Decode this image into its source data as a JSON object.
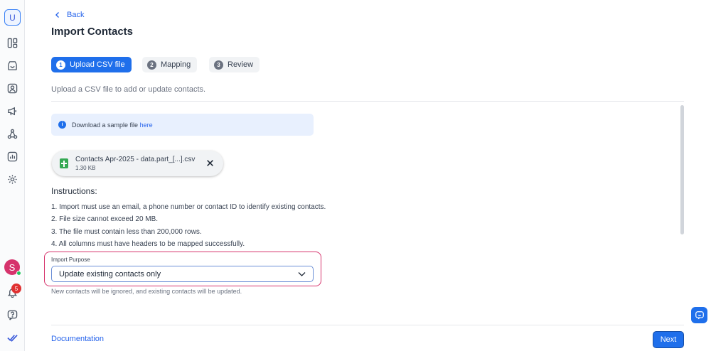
{
  "sidebar": {
    "logo_letter": "U",
    "items": [
      {
        "icon": "layout-icon"
      },
      {
        "icon": "inbox-icon"
      },
      {
        "icon": "contacts-icon"
      },
      {
        "icon": "megaphone-icon"
      },
      {
        "icon": "workflow-icon"
      },
      {
        "icon": "reports-icon"
      },
      {
        "icon": "gear-icon"
      }
    ],
    "avatar_letter": "S",
    "notification_count": "5"
  },
  "header": {
    "back_label": "Back",
    "title": "Import Contacts"
  },
  "steps": [
    {
      "number": "1",
      "label": "Upload CSV file",
      "active": true
    },
    {
      "number": "2",
      "label": "Mapping",
      "active": false
    },
    {
      "number": "3",
      "label": "Review",
      "active": false
    }
  ],
  "subtitle": "Upload a CSV file to add or update contacts.",
  "sample": {
    "icon_text": "i",
    "text": "Download a sample file ",
    "link": "here"
  },
  "file": {
    "name": "Contacts Apr-2025 - data.part_[...].csv",
    "size": "1.30 KB"
  },
  "instructions": {
    "title": "Instructions:",
    "items": [
      "1. Import must use an email, a phone number or contact ID to identify existing contacts.",
      "2. File size cannot exceed 20 MB.",
      "3. The file must contain less than 200,000 rows.",
      "4. All columns must have headers to be mapped successfully."
    ]
  },
  "import_purpose": {
    "label": "Import Purpose",
    "selected": "Update existing contacts only",
    "helper": "New contacts will be ignored, and existing contacts will be updated."
  },
  "footer": {
    "documentation_label": "Documentation",
    "next_label": "Next"
  },
  "colors": {
    "primary": "#1f6feb",
    "highlight": "#d6336c",
    "badge": "#e03131"
  }
}
